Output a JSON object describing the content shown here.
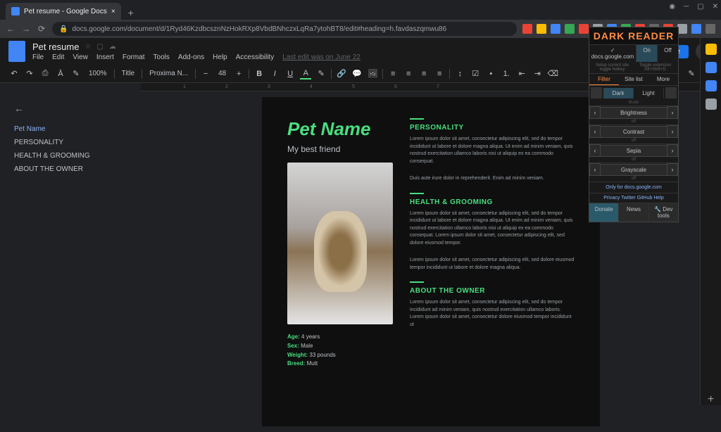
{
  "browser": {
    "tab_title": "Pet resume - Google Docs",
    "url": "docs.google.com/document/d/1Ryd46KzdbcsznNzHokRXp8VbdBNhczxLqRa7ytohBT8/edit#heading=h.favdaszqmwu86"
  },
  "docs": {
    "title": "Pet resume",
    "menu": [
      "File",
      "Edit",
      "View",
      "Insert",
      "Format",
      "Tools",
      "Add-ons",
      "Help",
      "Accessibility"
    ],
    "last_edit": "Last edit was on June 22",
    "share": "Share"
  },
  "toolbar": {
    "zoom": "100%",
    "style": "Title",
    "font": "Proxima N...",
    "size": "48"
  },
  "outline": {
    "items": [
      {
        "label": "Pet Name",
        "active": true
      },
      {
        "label": "PERSONALITY",
        "active": false
      },
      {
        "label": "HEALTH & GROOMING",
        "active": false
      },
      {
        "label": "ABOUT THE OWNER",
        "active": false
      }
    ]
  },
  "doc": {
    "title": "Pet Name",
    "subtitle": "My best friend",
    "stats": [
      {
        "k": "Age:",
        "v": "4 years"
      },
      {
        "k": "Sex:",
        "v": "Male"
      },
      {
        "k": "Weight:",
        "v": "33 pounds"
      },
      {
        "k": "Breed:",
        "v": "Mutt"
      }
    ],
    "sections": [
      {
        "title": "PERSONALITY",
        "body": "Lorem ipsum dolor sit amet, consectetur adipiscing elit, sed do tempor incididunt ut labore et dolore magna aliqua. Ut enim ad minim veniam, quis nostrud exercitation ullamco laboris nisi ut aliquip ex ea commodo consequat.",
        "extra": "Duis aute irure dolor in reprehenderit. Enim ad minim veniam."
      },
      {
        "title": "HEALTH & GROOMING",
        "body": "Lorem ipsum dolor sit amet, consectetur adipiscing elit, sed do tempor incididunt ut labore et dolore magna aliqua. Ut enim ad minim veniam, quis nostrud exercitation ullamco laboris nisi ut aliquip ex ea commodo consequat. Lorem ipsum dolor sit amet, consectetur adipiscing elit, sed dolore eiusmod tempor.",
        "extra": "Lorem ipsum dolor sit amet, consectetur adipiscing elit, sed dolore eiusmod tempor incididunt ut labore et dolore magna aliqua."
      },
      {
        "title": "ABOUT THE OWNER",
        "body": "Lorem ipsum dolor sit amet, consectetur adipiscing elit, sed do tempor incididunt ad minim veniam, quis nostrud exercitation ullamco laboris. Lorem ipsum dolor sit amet, consectetur dolore eiusmod tempor incididunt ut"
      }
    ]
  },
  "dr": {
    "title": "DARK READER",
    "site": "docs.google.com",
    "on": "On",
    "off": "Off",
    "hint_left": "Setup current site toggle hotkey",
    "hint_right": "Toggle extension Alt+Shift+D",
    "tabs": [
      "Filter",
      "Site list",
      "More"
    ],
    "dark": "Dark",
    "light": "Light",
    "mode": "Mode",
    "sliders": [
      {
        "label": "Brightness",
        "val": "off"
      },
      {
        "label": "Contrast",
        "val": "off"
      },
      {
        "label": "Sepia",
        "val": "off"
      },
      {
        "label": "Grayscale",
        "val": "off"
      }
    ],
    "only_prefix": "Only for",
    "only_site": "docs.google.com",
    "links": "Privacy   Twitter   GitHub   Help",
    "donate": "Donate",
    "news": "News",
    "devtools": "🔧 Dev tools"
  }
}
